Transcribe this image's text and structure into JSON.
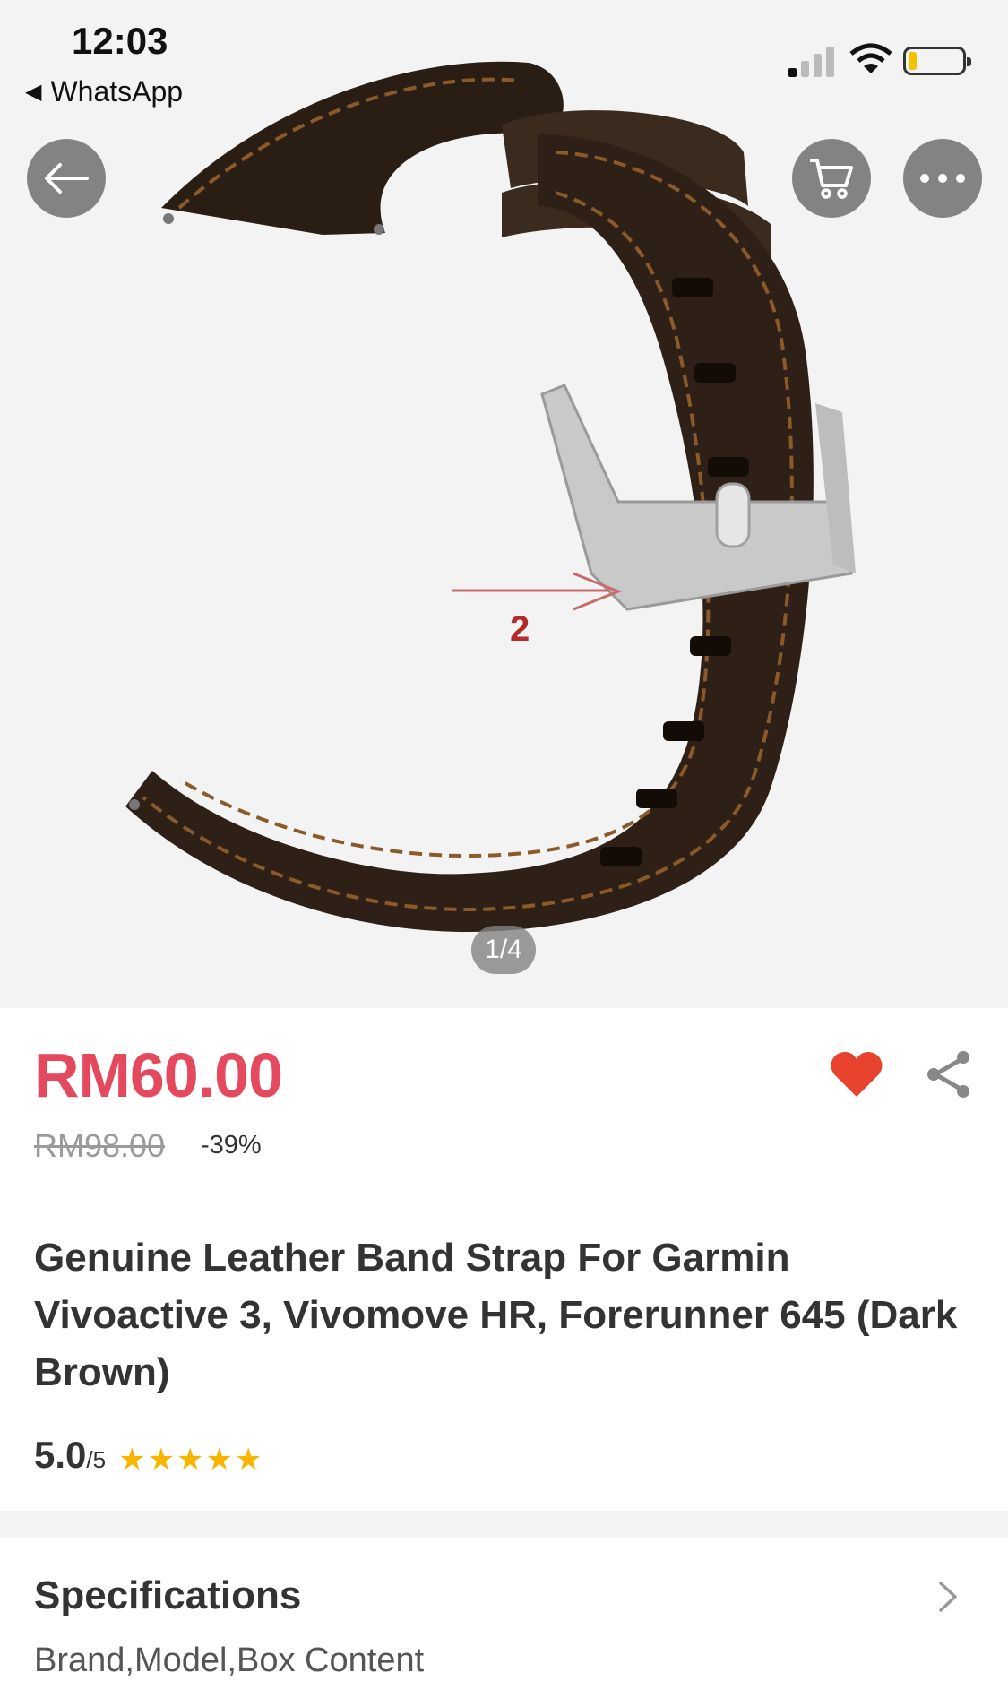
{
  "status_bar": {
    "time": "12:03",
    "back_app": "WhatsApp",
    "battery_level": 0.15
  },
  "gallery": {
    "counter": "1/4",
    "image_annotation": "2"
  },
  "icons": {
    "back": "arrow-left-icon",
    "cart": "cart-icon",
    "more": "more-dots-icon",
    "wishlist": "heart-icon",
    "share": "share-icon",
    "specs_chevron": "chevron-right-icon",
    "star": "star-icon"
  },
  "product": {
    "price": "RM60.00",
    "original_price": "RM98.00",
    "discount": "-39%",
    "title": "Genuine Leather Band Strap For Garmin Vivoactive 3, Vivomove HR, Forerunner 645 (Dark Brown)",
    "rating_score": "5.0",
    "rating_max": "/5",
    "stars": 5
  },
  "specifications": {
    "title": "Specifications",
    "summary": "Brand,Model,Box Content"
  },
  "colors": {
    "price": "#e5495e",
    "heart": "#e8432d",
    "star": "#f7b500",
    "overlay_button": "#6e6e6e"
  }
}
